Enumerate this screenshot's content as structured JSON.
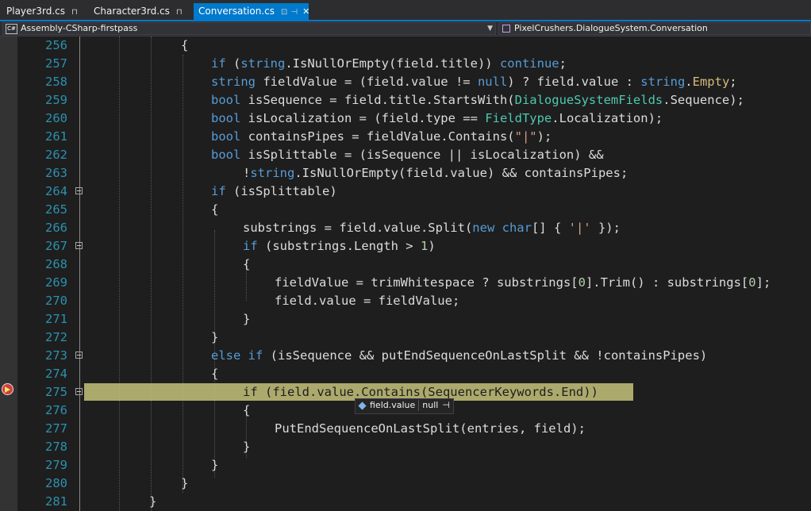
{
  "tabs": [
    {
      "label": "Player3rd.cs",
      "pin": "⊓"
    },
    {
      "label": "Character3rd.cs",
      "pin": "⊓"
    },
    {
      "label": "Conversation.cs",
      "pin": "⊡",
      "pin2": "⊣",
      "close": "✕"
    }
  ],
  "navbar": {
    "project_badge": "C#",
    "project": "Assembly-CSharp-firstpass",
    "class_name": "PixelCrushers.DialogueSystem.Conversation"
  },
  "datatip": {
    "name": "field.value",
    "value": "null",
    "pin": "⊣"
  },
  "lines": [
    {
      "n": "256",
      "html": "{"
    },
    {
      "n": "257",
      "html": "if (string.IsNullOrEmpty(field.title)) continue;"
    },
    {
      "n": "258",
      "html": "string fieldValue = (field.value != null) ? field.value : string.Empty;"
    },
    {
      "n": "259",
      "html": "bool isSequence = field.title.StartsWith(DialogueSystemFields.Sequence);"
    },
    {
      "n": "260",
      "html": "bool isLocalization = (field.type == FieldType.Localization);"
    },
    {
      "n": "261",
      "html": "bool containsPipes = fieldValue.Contains(\"|\");"
    },
    {
      "n": "262",
      "html": "bool isSplittable = (isSequence || isLocalization) &&"
    },
    {
      "n": "263",
      "html": "!string.IsNullOrEmpty(field.value) && containsPipes;"
    },
    {
      "n": "264",
      "html": "if (isSplittable)"
    },
    {
      "n": "265",
      "html": "{"
    },
    {
      "n": "266",
      "html": "substrings = field.value.Split(new char[] { '|' });"
    },
    {
      "n": "267",
      "html": "if (substrings.Length > 1)"
    },
    {
      "n": "268",
      "html": "{"
    },
    {
      "n": "269",
      "html": "fieldValue = trimWhitespace ? substrings[0].Trim() : substrings[0];"
    },
    {
      "n": "270",
      "html": "field.value = fieldValue;"
    },
    {
      "n": "271",
      "html": "}"
    },
    {
      "n": "272",
      "html": "}"
    },
    {
      "n": "273",
      "html": "else if (isSequence && putEndSequenceOnLastSplit && !containsPipes)"
    },
    {
      "n": "274",
      "html": "{"
    },
    {
      "n": "275",
      "html": "if (field.value.Contains(SequencerKeywords.End))"
    },
    {
      "n": "276",
      "html": "{"
    },
    {
      "n": "277",
      "html": "PutEndSequenceOnLastSplit(entries, field);"
    },
    {
      "n": "278",
      "html": "}"
    },
    {
      "n": "279",
      "html": "}"
    },
    {
      "n": "280",
      "html": "}"
    },
    {
      "n": "281",
      "html": "}"
    }
  ]
}
